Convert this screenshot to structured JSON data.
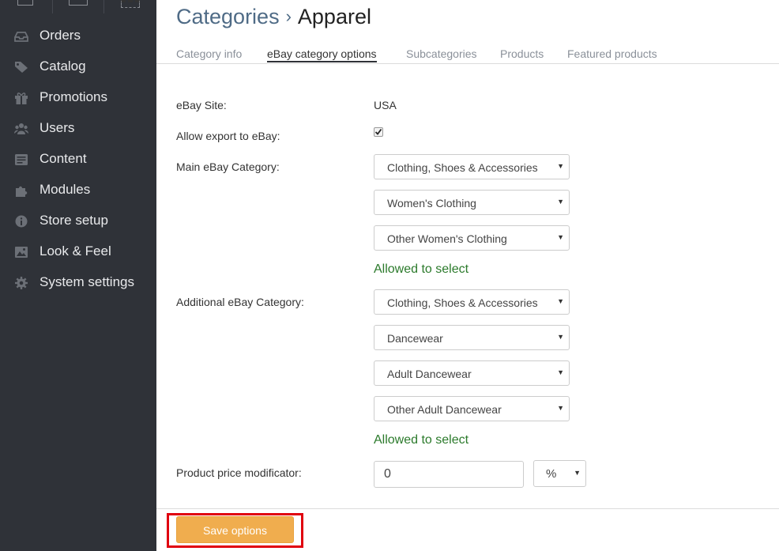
{
  "sidebar": {
    "items": [
      {
        "label": "Orders",
        "icon": "orders-icon"
      },
      {
        "label": "Catalog",
        "icon": "tag-icon"
      },
      {
        "label": "Promotions",
        "icon": "gift-icon"
      },
      {
        "label": "Users",
        "icon": "users-icon"
      },
      {
        "label": "Content",
        "icon": "content-icon"
      },
      {
        "label": "Modules",
        "icon": "puzzle-icon"
      },
      {
        "label": "Store setup",
        "icon": "info-icon"
      },
      {
        "label": "Look & Feel",
        "icon": "image-icon"
      },
      {
        "label": "System settings",
        "icon": "gear-icon"
      }
    ]
  },
  "header": {
    "breadcrumb_parent": "Categories",
    "breadcrumb_sep": "›",
    "title": "Apparel"
  },
  "tabs": [
    {
      "label": "Category info",
      "active": false
    },
    {
      "label": "eBay category options",
      "active": true
    },
    {
      "label": "Subcategories",
      "active": false
    },
    {
      "label": "Products",
      "active": false
    },
    {
      "label": "Featured products",
      "active": false
    }
  ],
  "form": {
    "site_label": "eBay Site:",
    "site_value": "USA",
    "export_label": "Allow export to eBay:",
    "export_checked": true,
    "main_label": "Main eBay Category:",
    "main_selects": [
      "Clothing, Shoes & Accessories",
      "Women's Clothing",
      "Other Women's Clothing"
    ],
    "main_status": "Allowed to select",
    "additional_label": "Additional eBay Category:",
    "additional_selects": [
      "Clothing, Shoes & Accessories",
      "Dancewear",
      "Adult Dancewear",
      "Other Adult Dancewear"
    ],
    "additional_status": "Allowed to select",
    "price_label": "Product price modificator:",
    "price_value": "0",
    "price_unit": "%"
  },
  "footer": {
    "save_label": "Save options"
  },
  "colors": {
    "sidebar_bg": "#2f3238",
    "allowed_green": "#2b7a2b",
    "save_button": "#f0ad4e",
    "highlight_border": "#e0000f"
  }
}
